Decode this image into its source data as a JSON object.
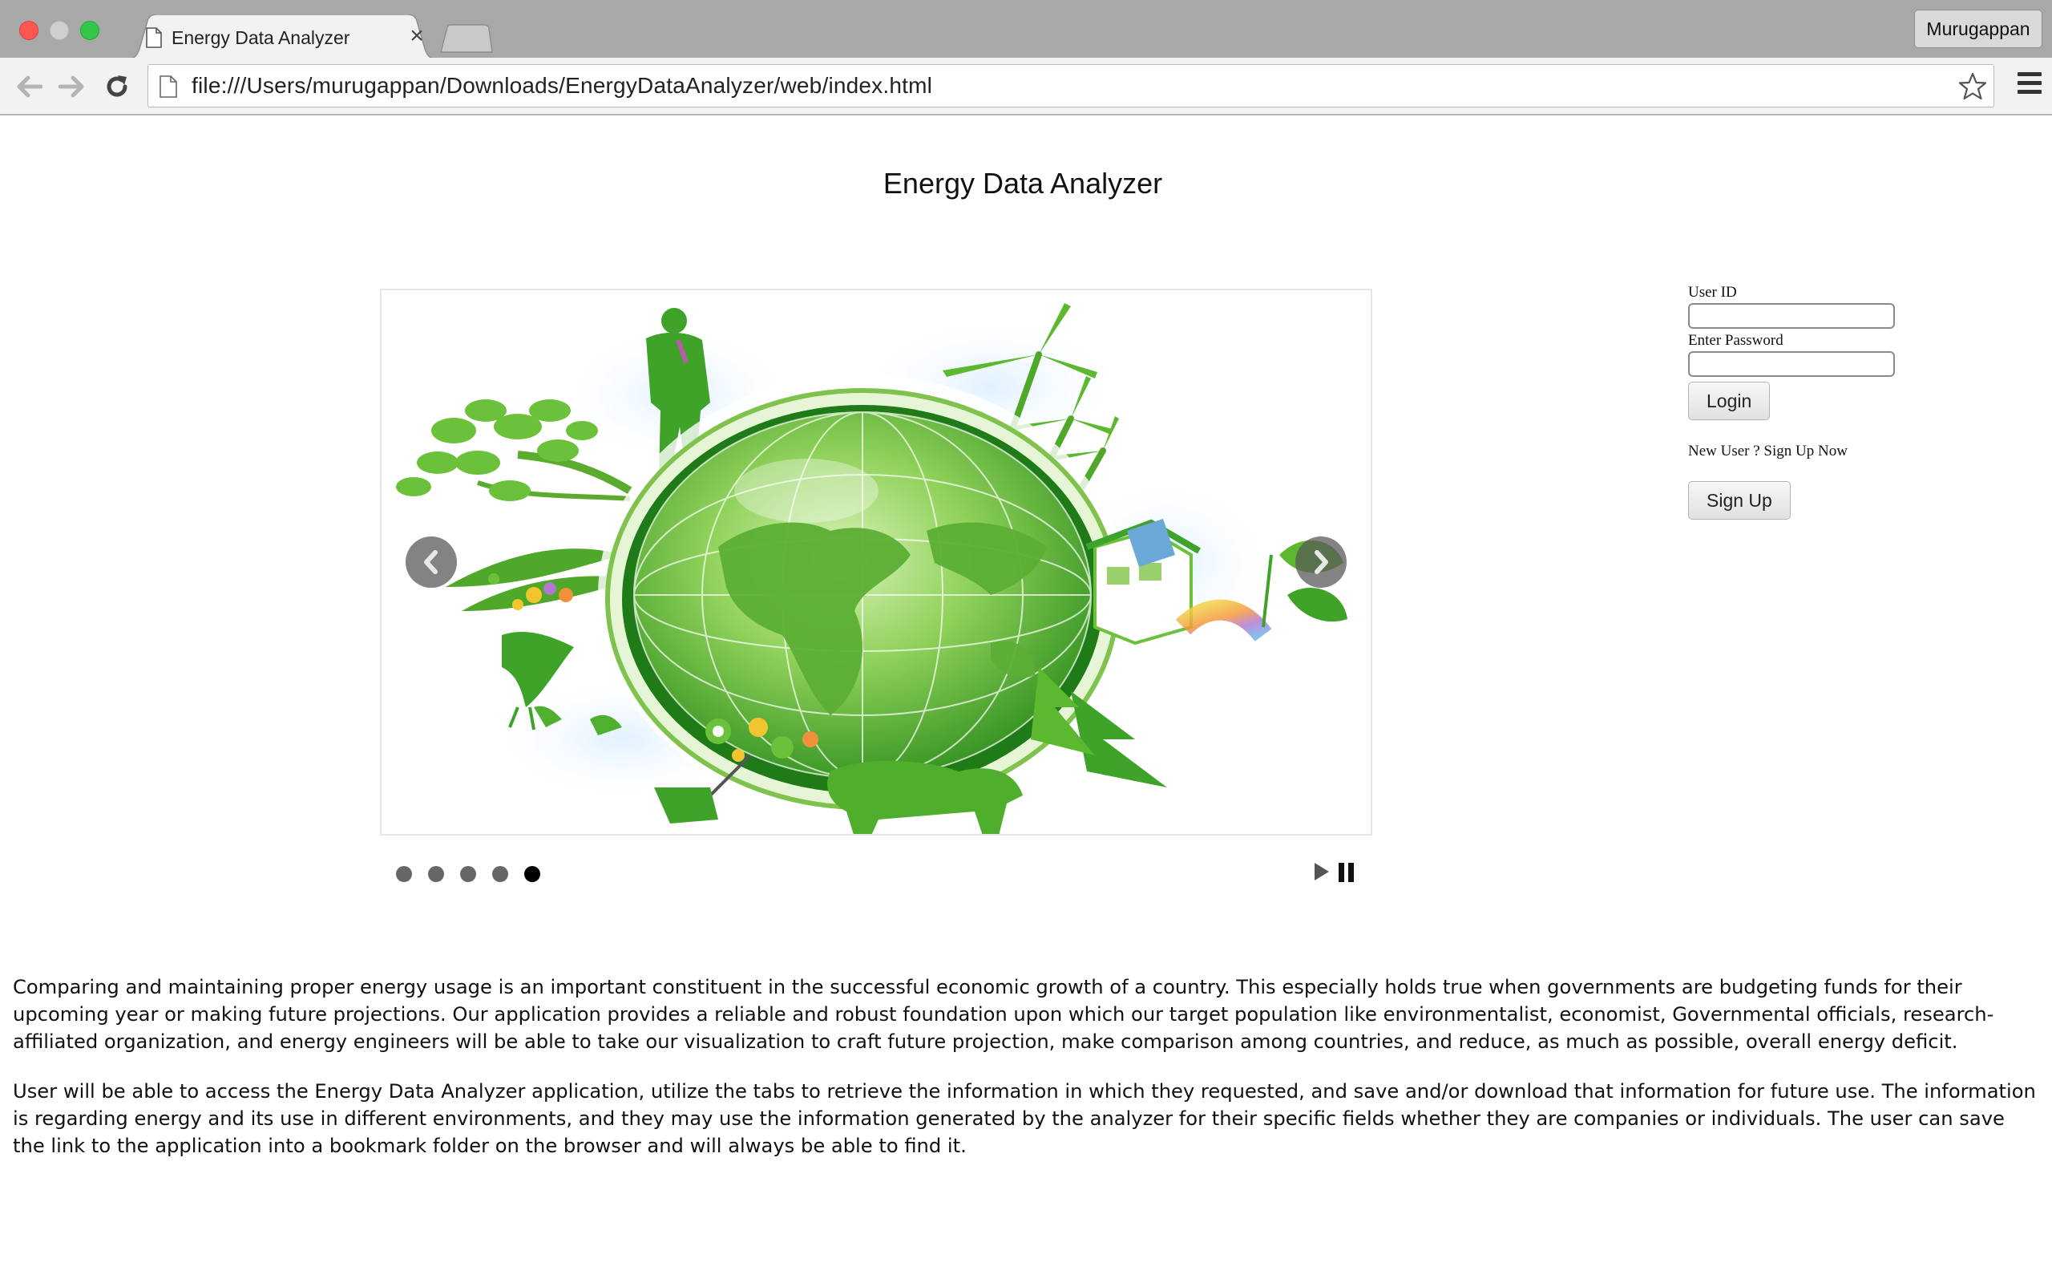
{
  "browser": {
    "tab_title": "Energy Data Analyzer",
    "tab_close": "×",
    "profile_name": "Murugappan",
    "url": "file:///Users/murugappan/Downloads/EnergyDataAnalyzer/web/index.html"
  },
  "page": {
    "title": "Energy Data Analyzer"
  },
  "carousel": {
    "slide_count": 5,
    "active_slide": 5,
    "slide_image": "green-earth-illustration"
  },
  "login": {
    "user_id_label": "User ID",
    "user_id_value": "",
    "password_label": "Enter Password",
    "password_value": "",
    "login_button": "Login",
    "signup_prompt": "New User ? Sign Up Now",
    "signup_button": "Sign Up"
  },
  "description": {
    "paragraph_1": "Comparing and maintaining proper energy usage is an important constituent in the successful economic growth of a country. This especially holds true when governments are budgeting funds for their upcoming year or making future projections. Our application provides a reliable and robust foundation upon which our target population like environmentalist, economist, Governmental officials, research-affiliated organization, and energy engineers will be able to take our visualization to craft future projection, make comparison among countries, and reduce, as much as possible, overall energy deficit.",
    "paragraph_2": "User will be able to access the Energy Data Analyzer application, utilize the tabs to retrieve the information in which they requested, and save and/or download that information for future use. The information is regarding energy and its use in different environments, and they may use the information generated by the analyzer for their specific fields whether they are companies or individuals. The user can save the link to the application into a bookmark folder on the browser and will always be able to find it."
  },
  "colors": {
    "accent_green": "#5cb82e",
    "dark_green": "#2e8b1e",
    "chrome_gray": "#a8a8a8"
  }
}
